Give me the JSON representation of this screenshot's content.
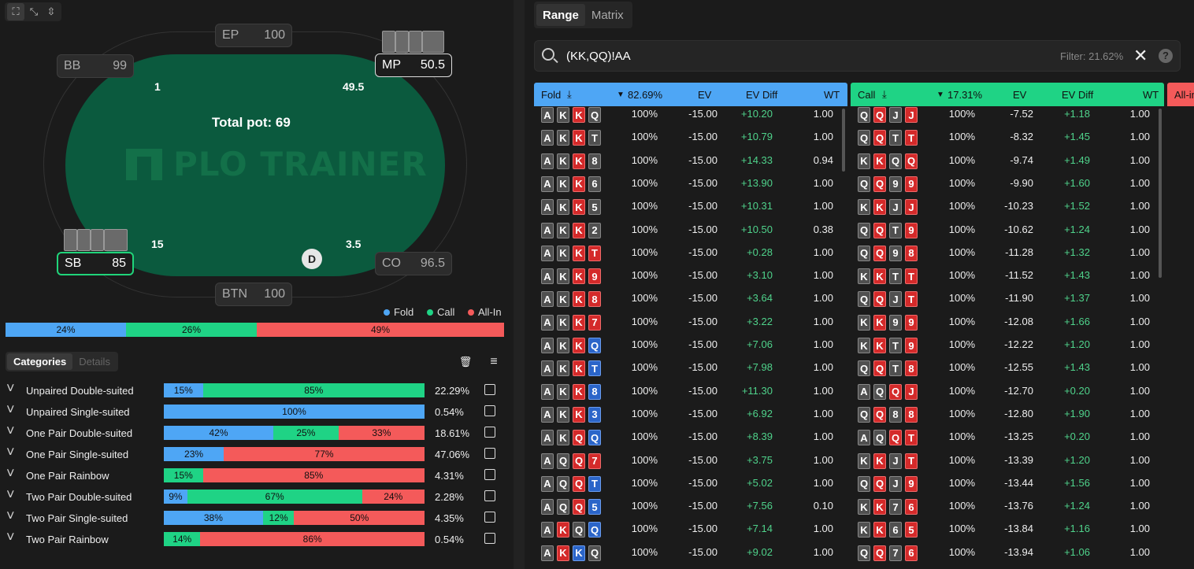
{
  "toolbar": {
    "icons": [
      "fullscreen-icon",
      "shrink-icon",
      "collapse-icon"
    ]
  },
  "table": {
    "seats": [
      {
        "pos": "EP",
        "stack": "100"
      },
      {
        "pos": "BB",
        "stack": "99"
      },
      {
        "pos": "MP",
        "stack": "50.5"
      },
      {
        "pos": "SB",
        "stack": "85"
      },
      {
        "pos": "CO",
        "stack": "96.5"
      },
      {
        "pos": "BTN",
        "stack": "100"
      }
    ],
    "bets": {
      "bb": "1",
      "mp": "49.5",
      "sb": "15",
      "co": "3.5"
    },
    "total_pot": "Total pot: 69",
    "watermark": "PLO TRAINER",
    "dealer": "D"
  },
  "legend": {
    "fold": "Fold",
    "call": "Call",
    "allin": "All-In"
  },
  "colors": {
    "fold": "#4ea6f5",
    "call": "#1fd385",
    "allin": "#f45a5a"
  },
  "overall": {
    "fold": 24,
    "call": 26,
    "allin": 49,
    "fold_label": "24%",
    "call_label": "26%",
    "allin_label": "49%"
  },
  "cat_tabs": {
    "categories": "Categories",
    "details": "Details"
  },
  "categories": [
    {
      "name": "Unpaired Double-suited",
      "fold": 15,
      "call": 85,
      "allin": 0,
      "fl": "15%",
      "cl": "85%",
      "al": "",
      "pct": "22.29%"
    },
    {
      "name": "Unpaired Single-suited",
      "fold": 100,
      "call": 0,
      "allin": 0,
      "fl": "100%",
      "cl": "",
      "al": "",
      "pct": "0.54%"
    },
    {
      "name": "One Pair Double-suited",
      "fold": 42,
      "call": 25,
      "allin": 33,
      "fl": "42%",
      "cl": "25%",
      "al": "33%",
      "pct": "18.61%"
    },
    {
      "name": "One Pair Single-suited",
      "fold": 23,
      "call": 0,
      "allin": 77,
      "fl": "23%",
      "cl": "",
      "al": "77%",
      "pct": "47.06%"
    },
    {
      "name": "One Pair Rainbow",
      "fold": 0,
      "call": 15,
      "allin": 85,
      "fl": "",
      "cl": "15%",
      "al": "85%",
      "pct": "4.31%"
    },
    {
      "name": "Two Pair Double-suited",
      "fold": 9,
      "call": 67,
      "allin": 24,
      "fl": "9%",
      "cl": "67%",
      "al": "24%",
      "pct": "2.28%"
    },
    {
      "name": "Two Pair Single-suited",
      "fold": 38,
      "call": 12,
      "allin": 50,
      "fl": "38%",
      "cl": "12%",
      "al": "50%",
      "pct": "4.35%"
    },
    {
      "name": "Two Pair Rainbow",
      "fold": 0,
      "call": 14,
      "allin": 86,
      "fl": "",
      "cl": "14%",
      "al": "86%",
      "pct": "0.54%"
    }
  ],
  "right_tabs": {
    "range": "Range",
    "matrix": "Matrix"
  },
  "search": {
    "value": "(KK,QQ)!AA",
    "filter": "Filter: 21.62%"
  },
  "fold_col": {
    "title": "Fold",
    "pct": "82.69%",
    "ev": "EV",
    "evdiff": "EV Diff",
    "wt": "WT"
  },
  "call_col": {
    "title": "Call",
    "pct": "17.31%",
    "ev": "EV",
    "evdiff": "EV Diff",
    "wt": "WT"
  },
  "allin_col": {
    "title": "All-in"
  },
  "fold_rows": [
    {
      "cards": [
        [
          "A",
          "g"
        ],
        [
          "K",
          "g"
        ],
        [
          "K",
          "r"
        ],
        [
          "Q",
          "g"
        ]
      ],
      "freq": "100%",
      "ev": "-15.00",
      "diff": "+10.20",
      "wt": "1.00"
    },
    {
      "cards": [
        [
          "A",
          "g"
        ],
        [
          "K",
          "g"
        ],
        [
          "K",
          "r"
        ],
        [
          "T",
          "g"
        ]
      ],
      "freq": "100%",
      "ev": "-15.00",
      "diff": "+10.79",
      "wt": "1.00"
    },
    {
      "cards": [
        [
          "A",
          "g"
        ],
        [
          "K",
          "g"
        ],
        [
          "K",
          "r"
        ],
        [
          "8",
          "g"
        ]
      ],
      "freq": "100%",
      "ev": "-15.00",
      "diff": "+14.33",
      "wt": "0.94"
    },
    {
      "cards": [
        [
          "A",
          "g"
        ],
        [
          "K",
          "g"
        ],
        [
          "K",
          "r"
        ],
        [
          "6",
          "g"
        ]
      ],
      "freq": "100%",
      "ev": "-15.00",
      "diff": "+13.90",
      "wt": "1.00"
    },
    {
      "cards": [
        [
          "A",
          "g"
        ],
        [
          "K",
          "g"
        ],
        [
          "K",
          "r"
        ],
        [
          "5",
          "g"
        ]
      ],
      "freq": "100%",
      "ev": "-15.00",
      "diff": "+10.31",
      "wt": "1.00"
    },
    {
      "cards": [
        [
          "A",
          "g"
        ],
        [
          "K",
          "g"
        ],
        [
          "K",
          "r"
        ],
        [
          "2",
          "g"
        ]
      ],
      "freq": "100%",
      "ev": "-15.00",
      "diff": "+10.50",
      "wt": "0.38"
    },
    {
      "cards": [
        [
          "A",
          "g"
        ],
        [
          "K",
          "g"
        ],
        [
          "K",
          "r"
        ],
        [
          "T",
          "r"
        ]
      ],
      "freq": "100%",
      "ev": "-15.00",
      "diff": "+0.28",
      "wt": "1.00"
    },
    {
      "cards": [
        [
          "A",
          "g"
        ],
        [
          "K",
          "g"
        ],
        [
          "K",
          "r"
        ],
        [
          "9",
          "r"
        ]
      ],
      "freq": "100%",
      "ev": "-15.00",
      "diff": "+3.10",
      "wt": "1.00"
    },
    {
      "cards": [
        [
          "A",
          "g"
        ],
        [
          "K",
          "g"
        ],
        [
          "K",
          "r"
        ],
        [
          "8",
          "r"
        ]
      ],
      "freq": "100%",
      "ev": "-15.00",
      "diff": "+3.64",
      "wt": "1.00"
    },
    {
      "cards": [
        [
          "A",
          "g"
        ],
        [
          "K",
          "g"
        ],
        [
          "K",
          "r"
        ],
        [
          "7",
          "r"
        ]
      ],
      "freq": "100%",
      "ev": "-15.00",
      "diff": "+3.22",
      "wt": "1.00"
    },
    {
      "cards": [
        [
          "A",
          "g"
        ],
        [
          "K",
          "g"
        ],
        [
          "K",
          "r"
        ],
        [
          "Q",
          "b"
        ]
      ],
      "freq": "100%",
      "ev": "-15.00",
      "diff": "+7.06",
      "wt": "1.00"
    },
    {
      "cards": [
        [
          "A",
          "g"
        ],
        [
          "K",
          "g"
        ],
        [
          "K",
          "r"
        ],
        [
          "T",
          "b"
        ]
      ],
      "freq": "100%",
      "ev": "-15.00",
      "diff": "+7.98",
      "wt": "1.00"
    },
    {
      "cards": [
        [
          "A",
          "g"
        ],
        [
          "K",
          "g"
        ],
        [
          "K",
          "r"
        ],
        [
          "8",
          "b"
        ]
      ],
      "freq": "100%",
      "ev": "-15.00",
      "diff": "+11.30",
      "wt": "1.00"
    },
    {
      "cards": [
        [
          "A",
          "g"
        ],
        [
          "K",
          "g"
        ],
        [
          "K",
          "r"
        ],
        [
          "3",
          "b"
        ]
      ],
      "freq": "100%",
      "ev": "-15.00",
      "diff": "+6.92",
      "wt": "1.00"
    },
    {
      "cards": [
        [
          "A",
          "g"
        ],
        [
          "K",
          "g"
        ],
        [
          "Q",
          "r"
        ],
        [
          "Q",
          "b"
        ]
      ],
      "freq": "100%",
      "ev": "-15.00",
      "diff": "+8.39",
      "wt": "1.00"
    },
    {
      "cards": [
        [
          "A",
          "g"
        ],
        [
          "Q",
          "g"
        ],
        [
          "Q",
          "r"
        ],
        [
          "7",
          "r"
        ]
      ],
      "freq": "100%",
      "ev": "-15.00",
      "diff": "+3.75",
      "wt": "1.00"
    },
    {
      "cards": [
        [
          "A",
          "g"
        ],
        [
          "Q",
          "g"
        ],
        [
          "Q",
          "r"
        ],
        [
          "T",
          "b"
        ]
      ],
      "freq": "100%",
      "ev": "-15.00",
      "diff": "+5.02",
      "wt": "1.00"
    },
    {
      "cards": [
        [
          "A",
          "g"
        ],
        [
          "Q",
          "g"
        ],
        [
          "Q",
          "r"
        ],
        [
          "5",
          "b"
        ]
      ],
      "freq": "100%",
      "ev": "-15.00",
      "diff": "+7.56",
      "wt": "0.10"
    },
    {
      "cards": [
        [
          "A",
          "g"
        ],
        [
          "K",
          "r"
        ],
        [
          "Q",
          "g"
        ],
        [
          "Q",
          "b"
        ]
      ],
      "freq": "100%",
      "ev": "-15.00",
      "diff": "+7.14",
      "wt": "1.00"
    },
    {
      "cards": [
        [
          "A",
          "g"
        ],
        [
          "K",
          "r"
        ],
        [
          "K",
          "b"
        ],
        [
          "Q",
          "g"
        ]
      ],
      "freq": "100%",
      "ev": "-15.00",
      "diff": "+9.02",
      "wt": "1.00"
    }
  ],
  "call_rows": [
    {
      "cards": [
        [
          "Q",
          "g"
        ],
        [
          "Q",
          "r"
        ],
        [
          "J",
          "g"
        ],
        [
          "J",
          "r"
        ]
      ],
      "freq": "100%",
      "ev": "-7.52",
      "diff": "+1.18",
      "wt": "1.00"
    },
    {
      "cards": [
        [
          "Q",
          "g"
        ],
        [
          "Q",
          "r"
        ],
        [
          "T",
          "g"
        ],
        [
          "T",
          "r"
        ]
      ],
      "freq": "100%",
      "ev": "-8.32",
      "diff": "+1.45",
      "wt": "1.00"
    },
    {
      "cards": [
        [
          "K",
          "g"
        ],
        [
          "K",
          "r"
        ],
        [
          "Q",
          "g"
        ],
        [
          "Q",
          "r"
        ]
      ],
      "freq": "100%",
      "ev": "-9.74",
      "diff": "+1.49",
      "wt": "1.00"
    },
    {
      "cards": [
        [
          "Q",
          "g"
        ],
        [
          "Q",
          "r"
        ],
        [
          "9",
          "g"
        ],
        [
          "9",
          "r"
        ]
      ],
      "freq": "100%",
      "ev": "-9.90",
      "diff": "+1.60",
      "wt": "1.00"
    },
    {
      "cards": [
        [
          "K",
          "g"
        ],
        [
          "K",
          "r"
        ],
        [
          "J",
          "g"
        ],
        [
          "J",
          "r"
        ]
      ],
      "freq": "100%",
      "ev": "-10.23",
      "diff": "+1.52",
      "wt": "1.00"
    },
    {
      "cards": [
        [
          "Q",
          "g"
        ],
        [
          "Q",
          "r"
        ],
        [
          "T",
          "g"
        ],
        [
          "9",
          "r"
        ]
      ],
      "freq": "100%",
      "ev": "-10.62",
      "diff": "+1.24",
      "wt": "1.00"
    },
    {
      "cards": [
        [
          "Q",
          "g"
        ],
        [
          "Q",
          "r"
        ],
        [
          "9",
          "g"
        ],
        [
          "8",
          "r"
        ]
      ],
      "freq": "100%",
      "ev": "-11.28",
      "diff": "+1.32",
      "wt": "1.00"
    },
    {
      "cards": [
        [
          "K",
          "g"
        ],
        [
          "K",
          "r"
        ],
        [
          "T",
          "g"
        ],
        [
          "T",
          "r"
        ]
      ],
      "freq": "100%",
      "ev": "-11.52",
      "diff": "+1.43",
      "wt": "1.00"
    },
    {
      "cards": [
        [
          "Q",
          "g"
        ],
        [
          "Q",
          "r"
        ],
        [
          "J",
          "g"
        ],
        [
          "T",
          "r"
        ]
      ],
      "freq": "100%",
      "ev": "-11.90",
      "diff": "+1.37",
      "wt": "1.00"
    },
    {
      "cards": [
        [
          "K",
          "g"
        ],
        [
          "K",
          "r"
        ],
        [
          "9",
          "g"
        ],
        [
          "9",
          "r"
        ]
      ],
      "freq": "100%",
      "ev": "-12.08",
      "diff": "+1.66",
      "wt": "1.00"
    },
    {
      "cards": [
        [
          "K",
          "g"
        ],
        [
          "K",
          "r"
        ],
        [
          "T",
          "g"
        ],
        [
          "9",
          "r"
        ]
      ],
      "freq": "100%",
      "ev": "-12.22",
      "diff": "+1.20",
      "wt": "1.00"
    },
    {
      "cards": [
        [
          "Q",
          "g"
        ],
        [
          "Q",
          "r"
        ],
        [
          "T",
          "g"
        ],
        [
          "8",
          "r"
        ]
      ],
      "freq": "100%",
      "ev": "-12.55",
      "diff": "+1.43",
      "wt": "1.00"
    },
    {
      "cards": [
        [
          "A",
          "g"
        ],
        [
          "Q",
          "g"
        ],
        [
          "Q",
          "r"
        ],
        [
          "J",
          "r"
        ]
      ],
      "freq": "100%",
      "ev": "-12.70",
      "diff": "+0.20",
      "wt": "1.00"
    },
    {
      "cards": [
        [
          "Q",
          "g"
        ],
        [
          "Q",
          "r"
        ],
        [
          "8",
          "g"
        ],
        [
          "8",
          "r"
        ]
      ],
      "freq": "100%",
      "ev": "-12.80",
      "diff": "+1.90",
      "wt": "1.00"
    },
    {
      "cards": [
        [
          "A",
          "g"
        ],
        [
          "Q",
          "g"
        ],
        [
          "Q",
          "r"
        ],
        [
          "T",
          "r"
        ]
      ],
      "freq": "100%",
      "ev": "-13.25",
      "diff": "+0.20",
      "wt": "1.00"
    },
    {
      "cards": [
        [
          "K",
          "g"
        ],
        [
          "K",
          "r"
        ],
        [
          "J",
          "g"
        ],
        [
          "T",
          "r"
        ]
      ],
      "freq": "100%",
      "ev": "-13.39",
      "diff": "+1.20",
      "wt": "1.00"
    },
    {
      "cards": [
        [
          "Q",
          "g"
        ],
        [
          "Q",
          "r"
        ],
        [
          "J",
          "g"
        ],
        [
          "9",
          "r"
        ]
      ],
      "freq": "100%",
      "ev": "-13.44",
      "diff": "+1.56",
      "wt": "1.00"
    },
    {
      "cards": [
        [
          "K",
          "g"
        ],
        [
          "K",
          "r"
        ],
        [
          "7",
          "g"
        ],
        [
          "6",
          "r"
        ]
      ],
      "freq": "100%",
      "ev": "-13.76",
      "diff": "+1.24",
      "wt": "1.00"
    },
    {
      "cards": [
        [
          "K",
          "g"
        ],
        [
          "K",
          "r"
        ],
        [
          "6",
          "g"
        ],
        [
          "5",
          "r"
        ]
      ],
      "freq": "100%",
      "ev": "-13.84",
      "diff": "+1.16",
      "wt": "1.00"
    },
    {
      "cards": [
        [
          "Q",
          "g"
        ],
        [
          "Q",
          "r"
        ],
        [
          "7",
          "g"
        ],
        [
          "6",
          "r"
        ]
      ],
      "freq": "100%",
      "ev": "-13.94",
      "diff": "+1.06",
      "wt": "1.00"
    }
  ]
}
